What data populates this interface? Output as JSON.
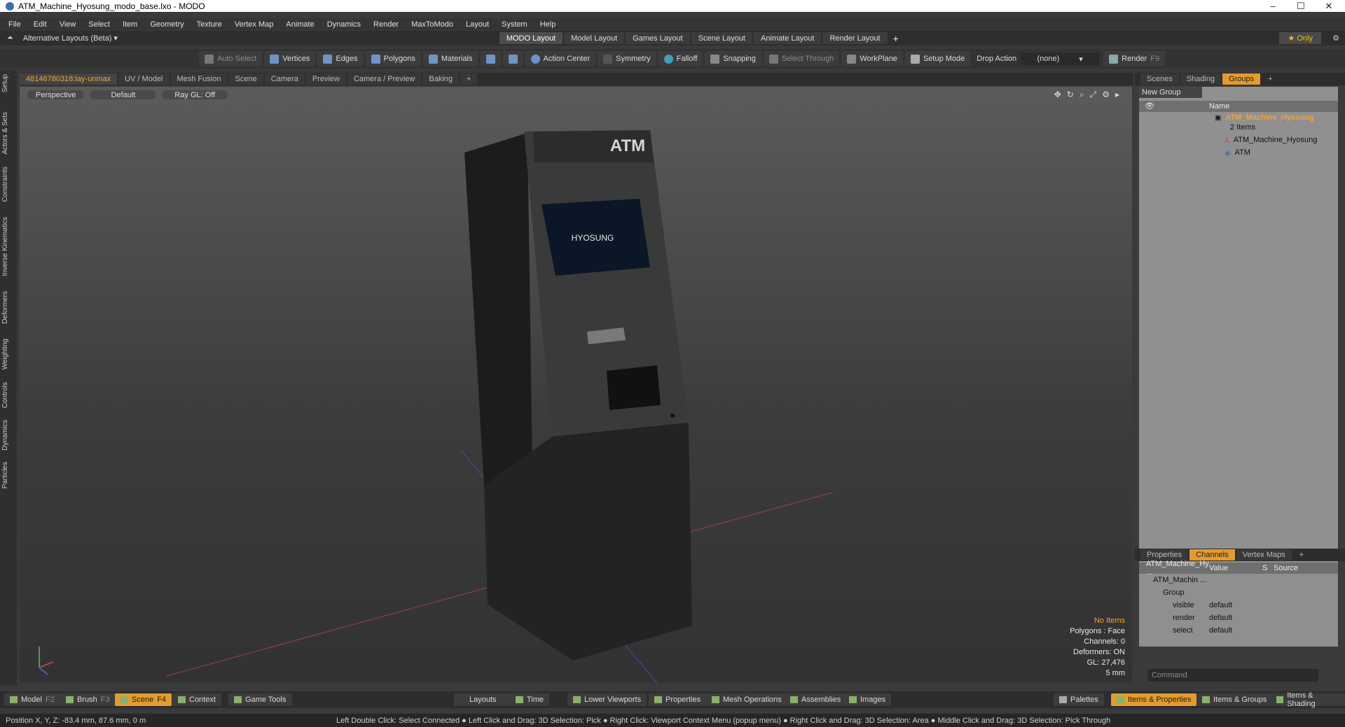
{
  "window": {
    "title": "ATM_Machine_Hyosung_modo_base.lxo - MODO"
  },
  "menu": [
    "File",
    "Edit",
    "View",
    "Select",
    "Item",
    "Geometry",
    "Texture",
    "Vertex Map",
    "Animate",
    "Dynamics",
    "Render",
    "MaxToModo",
    "Layout",
    "System",
    "Help"
  ],
  "layoutbar": {
    "alt_layouts": "Alternative Layouts (Beta) ▾",
    "tabs": [
      "MODO Layout",
      "Model Layout",
      "Games Layout",
      "Scene Layout",
      "Animate Layout",
      "Render Layout"
    ],
    "add": "+",
    "only": "★ Only"
  },
  "toolbar": {
    "auto_select": "Auto Select",
    "vertices": "Vertices",
    "edges": "Edges",
    "polygons": "Polygons",
    "materials": "Materials",
    "action_center": "Action Center",
    "symmetry": "Symmetry",
    "falloff": "Falloff",
    "snapping": "Snapping",
    "select_through": "Select Through",
    "workplane": "WorkPlane",
    "setup_mode": "Setup Mode",
    "drop_action": "Drop Action",
    "drop_value": "(none)",
    "render": "Render"
  },
  "left_tabs": [
    "Setup",
    "Actors & Sets",
    "Constraints",
    "Inverse Kinematics",
    "Deformers",
    "Weighting",
    "Controls",
    "Dynamics",
    "Particles"
  ],
  "view_tabs": [
    "48146780318:lay-unmax",
    "UV / Model",
    "Mesh Fusion",
    "Scene",
    "Camera",
    "Preview",
    "Camera / Preview",
    "Baking",
    "+"
  ],
  "viewport": {
    "perspective": "Perspective",
    "default": "Default",
    "raygl": "Ray GL: Off",
    "hud": {
      "no_items": "No Items",
      "polygons": "Polygons : Face",
      "channels": "Channels: 0",
      "deformers": "Deformers: ON",
      "gl": "GL: 27,476",
      "scale": "5 mm"
    },
    "atm_label": "ATM",
    "brand": "HYOSUNG"
  },
  "right_panel": {
    "tabs": [
      "Scenes",
      "Shading",
      "Groups",
      "+"
    ],
    "new_group": "New Group",
    "name_col": "Name",
    "tree": {
      "root": "ATM_Machine_Hyosung",
      "count": "2 Items",
      "child1": "ATM_Machine_Hyosung",
      "child2": "ATM"
    },
    "lower_tabs": [
      "Properties",
      "Channels",
      "Vertex Maps",
      "+"
    ],
    "chan_header": {
      "name": "ATM_Machine_Hy ...",
      "value": "Value",
      "s": "S",
      "source": "Source"
    },
    "chan_rows": [
      {
        "name": "ATM_Machin ...",
        "value": ""
      },
      {
        "name": "Group",
        "value": ""
      },
      {
        "name": "visible",
        "value": "default"
      },
      {
        "name": "render",
        "value": "default"
      },
      {
        "name": "select",
        "value": "default"
      }
    ],
    "command": "Command"
  },
  "bottom": {
    "model": "Model",
    "f2": "F2",
    "brush": "Brush",
    "f3": "F3",
    "scene": "Scene",
    "f4": "F4",
    "context": "Context",
    "game_tools": "Game Tools",
    "layouts": "Layouts",
    "time": "Time",
    "lower_viewports": "Lower Viewports",
    "properties": "Properties",
    "mesh_operations": "Mesh Operations",
    "assemblies": "Assemblies",
    "images": "Images",
    "palettes": "Palettes",
    "items_properties": "Items & Properties",
    "items_groups": "Items & Groups",
    "items_shading": "Items & Shading"
  },
  "status": {
    "position": "Position X, Y, Z:  -83.4 mm, 87.6 mm, 0 m",
    "hints": "Left Double Click: Select Connected ● Left Click and Drag: 3D Selection: Pick ● Right Click: Viewport Context Menu (popup menu) ● Right Click and Drag: 3D Selection: Area ● Middle Click and Drag: 3D Selection: Pick Through"
  }
}
